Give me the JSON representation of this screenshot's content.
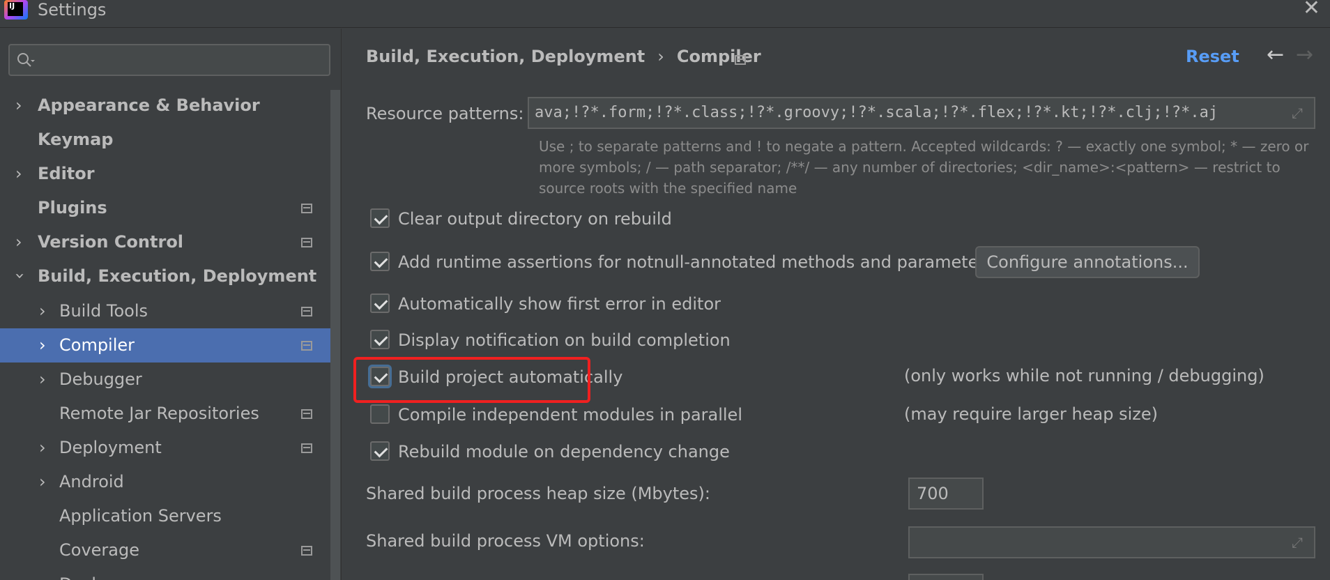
{
  "window": {
    "title": "Settings",
    "app_icon_text": "IJ"
  },
  "search": {
    "placeholder": ""
  },
  "sidebar": {
    "items": [
      {
        "label": "Appearance & Behavior",
        "bold": true
      },
      {
        "label": "Keymap",
        "bold": true
      },
      {
        "label": "Editor",
        "bold": true
      },
      {
        "label": "Plugins",
        "bold": true
      },
      {
        "label": "Version Control",
        "bold": true
      },
      {
        "label": "Build, Execution, Deployment",
        "bold": true
      },
      {
        "label": "Build Tools"
      },
      {
        "label": "Compiler"
      },
      {
        "label": "Debugger"
      },
      {
        "label": "Remote Jar Repositories"
      },
      {
        "label": "Deployment"
      },
      {
        "label": "Android"
      },
      {
        "label": "Application Servers"
      },
      {
        "label": "Coverage"
      },
      {
        "label": "Docker"
      }
    ]
  },
  "header": {
    "crumb_parent": "Build, Execution, Deployment",
    "crumb_sep": "›",
    "crumb_current": "Compiler",
    "reset": "Reset",
    "back_icon": "arrow-left-icon",
    "forward_icon": "arrow-right-icon"
  },
  "resource": {
    "label": "Resource patterns:",
    "value": "ava;!?*.form;!?*.class;!?*.groovy;!?*.scala;!?*.flex;!?*.kt;!?*.clj;!?*.aj",
    "hint": "Use ; to separate patterns and ! to negate a pattern. Accepted wildcards: ? — exactly one symbol; * — zero or more symbols; / — path separator; /**/ — any number of directories; <dir_name>:<pattern> — restrict to source roots with the specified name"
  },
  "options": [
    {
      "label": "Clear output directory on rebuild",
      "checked": true
    },
    {
      "label": "Add runtime assertions for notnull-annotated methods and parameters",
      "checked": true
    },
    {
      "label": "Automatically show first error in editor",
      "checked": true
    },
    {
      "label": "Display notification on build completion",
      "checked": true
    },
    {
      "label": "Build project automatically",
      "checked": true,
      "note": "(only works while not running / debugging)"
    },
    {
      "label": "Compile independent modules in parallel",
      "checked": false,
      "note": "(may require larger heap size)"
    },
    {
      "label": "Rebuild module on dependency change",
      "checked": true
    }
  ],
  "configure_button": "Configure annotations...",
  "heap": {
    "label": "Shared build process heap size (Mbytes):",
    "value": "700"
  },
  "vm": {
    "label": "Shared build process VM options:",
    "value": ""
  }
}
